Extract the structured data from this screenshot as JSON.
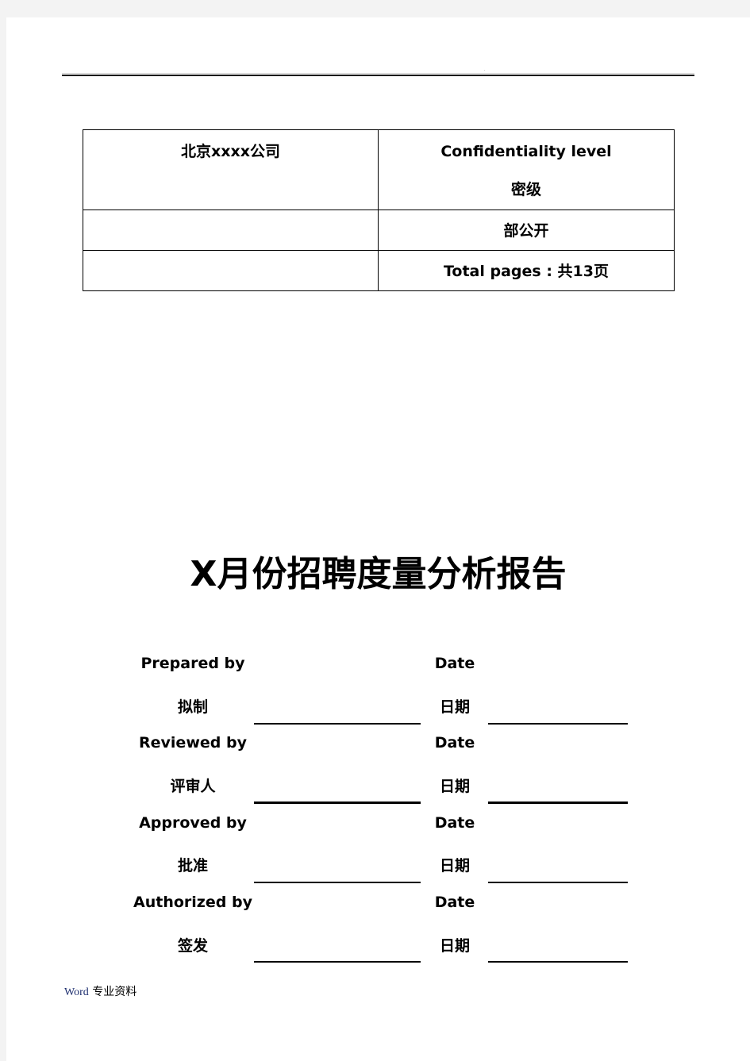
{
  "header": {
    "mark": "·"
  },
  "info_table": {
    "company": "北京xxxx公司",
    "confidentiality_label_en": "Confidentiality  level",
    "confidentiality_label_cn": "密级",
    "confidentiality_value": "部公开",
    "row2_left": "",
    "row3_left": "",
    "total_pages": "Total  pages : 共13页"
  },
  "title": "X月份招聘度量分析报告",
  "signatures": [
    {
      "role_en": "Prepared  by",
      "role_cn": "拟制",
      "date_en": "Date",
      "date_cn": "日期",
      "name_value": "",
      "date_value": ""
    },
    {
      "role_en": "Reviewed  by",
      "role_cn": "评审人",
      "date_en": "Date",
      "date_cn": "日期",
      "name_value": "",
      "date_value": ""
    },
    {
      "role_en": "Approved  by",
      "role_cn": "批准",
      "date_en": "Date",
      "date_cn": "日期",
      "name_value": "",
      "date_value": ""
    },
    {
      "role_en": "Authorized  by",
      "role_cn": "签发",
      "date_en": "Date",
      "date_cn": "日期",
      "name_value": "",
      "date_value": ""
    }
  ],
  "footer": {
    "word": "Word",
    "text": " 专业资料"
  }
}
